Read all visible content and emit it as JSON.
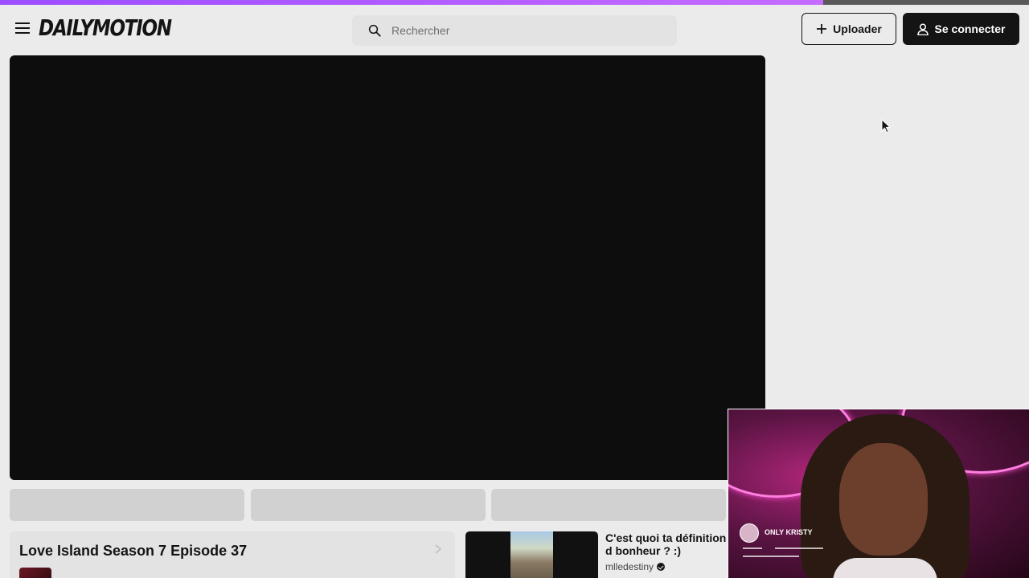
{
  "progress": {
    "value_fraction": 0.8
  },
  "header": {
    "menu_icon": "hamburger-menu-icon",
    "logo": "DAILYMOTION",
    "search": {
      "placeholder": "Rechercher",
      "icon": "search-icon"
    },
    "upload_button": {
      "label": "Uploader",
      "icon": "plus-icon"
    },
    "login_button": {
      "label": "Se connecter",
      "icon": "user-icon"
    }
  },
  "player": {
    "background": "#0d0d0e"
  },
  "playlist": {
    "title": "Love Island Season 7 Episode 37",
    "icon": "chevron-right-icon"
  },
  "recommendation": {
    "title": "C'est quoi ta définition d bonheur ? :)",
    "channel": "mlledestiny",
    "verified_icon": "verified-badge-icon"
  },
  "webcam_overlay": {
    "name": "ONLY KRISTY"
  },
  "colors": {
    "background": "#ebebeb",
    "dark": "#141414",
    "accent": "#9c4dff"
  }
}
